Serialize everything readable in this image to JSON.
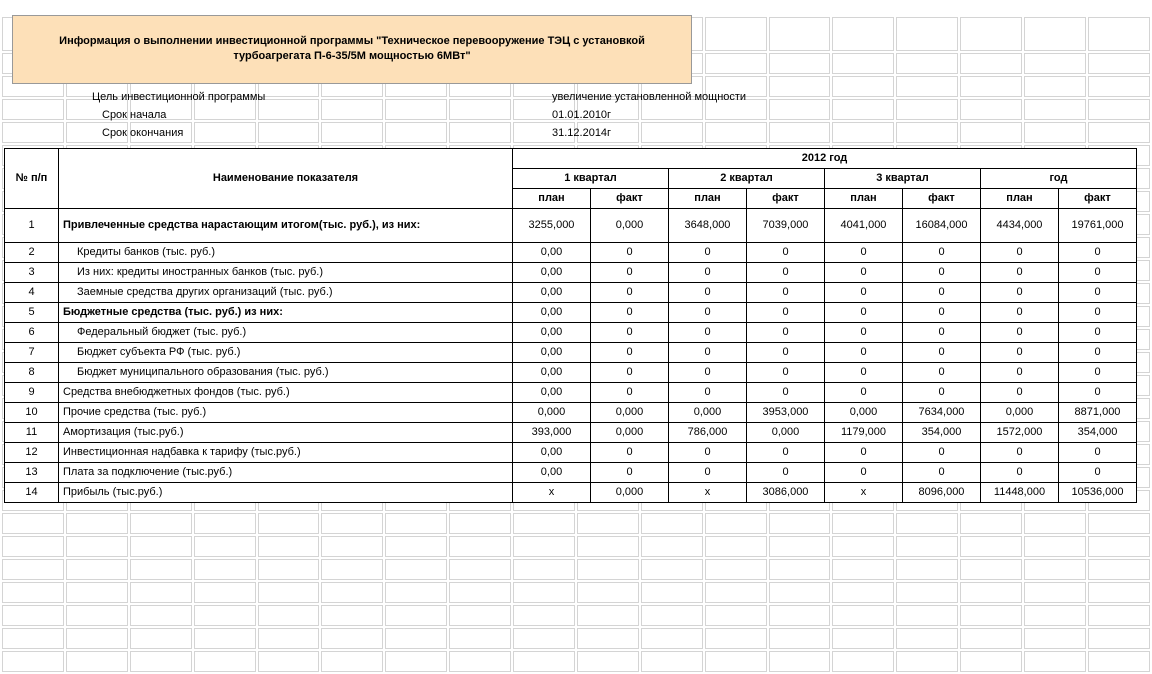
{
  "title": "Информация о выполнении инвестиционной программы  \"Техническое перевооружение ТЭЦ с установкой турбоагрегата П-6-35/5М мощностью 6МВт\"",
  "meta": {
    "goal_label": "Цель инвестиционной программы",
    "goal_value": "увеличение установленной мощности",
    "start_label": "Срок начала",
    "start_value": "01.01.2010г",
    "end_label": "Срок окончания",
    "end_value": "31.12.2014г"
  },
  "headers": {
    "num": "№ п/п",
    "name": "Наименование показателя",
    "year": "2012 год",
    "q1": "1 квартал",
    "q2": "2 квартал",
    "q3": "3 квартал",
    "year_col": "год",
    "plan": "план",
    "fact": "факт"
  },
  "rows": [
    {
      "num": "1",
      "name": "Привлеченные средства нарастающим итогом(тыс. руб.), из них:",
      "bold": true,
      "indent": 0,
      "q1p": "3255,000",
      "q1f": "0,000",
      "q2p": "3648,000",
      "q2f": "7039,000",
      "q3p": "4041,000",
      "q3f": "16084,000",
      "yp": "4434,000",
      "yf": "19761,000"
    },
    {
      "num": "2",
      "name": "Кредиты банков (тыс. руб.)",
      "bold": false,
      "indent": 1,
      "q1p": "0,00",
      "q1f": "0",
      "q2p": "0",
      "q2f": "0",
      "q3p": "0",
      "q3f": "0",
      "yp": "0",
      "yf": "0"
    },
    {
      "num": "3",
      "name": "Из них: кредиты иностранных банков (тыс. руб.)",
      "bold": false,
      "indent": 1,
      "q1p": "0,00",
      "q1f": "0",
      "q2p": "0",
      "q2f": "0",
      "q3p": "0",
      "q3f": "0",
      "yp": "0",
      "yf": "0"
    },
    {
      "num": "4",
      "name": "Заемные средства других организаций (тыс. руб.)",
      "bold": false,
      "indent": 1,
      "q1p": "0,00",
      "q1f": "0",
      "q2p": "0",
      "q2f": "0",
      "q3p": "0",
      "q3f": "0",
      "yp": "0",
      "yf": "0"
    },
    {
      "num": "5",
      "name": "Бюджетные средства (тыс. руб.) из них:",
      "bold": true,
      "indent": 0,
      "q1p": "0,00",
      "q1f": "0",
      "q2p": "0",
      "q2f": "0",
      "q3p": "0",
      "q3f": "0",
      "yp": "0",
      "yf": "0"
    },
    {
      "num": "6",
      "name": "Федеральный бюджет (тыс. руб.)",
      "bold": false,
      "indent": 1,
      "q1p": "0,00",
      "q1f": "0",
      "q2p": "0",
      "q2f": "0",
      "q3p": "0",
      "q3f": "0",
      "yp": "0",
      "yf": "0"
    },
    {
      "num": "7",
      "name": "Бюджет субъекта РФ (тыс. руб.)",
      "bold": false,
      "indent": 1,
      "q1p": "0,00",
      "q1f": "0",
      "q2p": "0",
      "q2f": "0",
      "q3p": "0",
      "q3f": "0",
      "yp": "0",
      "yf": "0"
    },
    {
      "num": "8",
      "name": "Бюджет муниципального образования (тыс. руб.)",
      "bold": false,
      "indent": 1,
      "q1p": "0,00",
      "q1f": "0",
      "q2p": "0",
      "q2f": "0",
      "q3p": "0",
      "q3f": "0",
      "yp": "0",
      "yf": "0"
    },
    {
      "num": "9",
      "name": "Средства внебюджетных фондов (тыс. руб.)",
      "bold": false,
      "indent": 0,
      "q1p": "0,00",
      "q1f": "0",
      "q2p": "0",
      "q2f": "0",
      "q3p": "0",
      "q3f": "0",
      "yp": "0",
      "yf": "0"
    },
    {
      "num": "10",
      "name": "Прочие средства (тыс. руб.)",
      "bold": false,
      "indent": 0,
      "q1p": "0,000",
      "q1f": "0,000",
      "q2p": "0,000",
      "q2f": "3953,000",
      "q3p": "0,000",
      "q3f": "7634,000",
      "yp": "0,000",
      "yf": "8871,000"
    },
    {
      "num": "11",
      "name": "Амортизация (тыс.руб.)",
      "bold": false,
      "indent": 0,
      "q1p": "393,000",
      "q1f": "0,000",
      "q2p": "786,000",
      "q2f": "0,000",
      "q3p": "1179,000",
      "q3f": "354,000",
      "yp": "1572,000",
      "yf": "354,000"
    },
    {
      "num": "12",
      "name": "Инвестиционная надбавка к тарифу (тыс.руб.)",
      "bold": false,
      "indent": 0,
      "q1p": "0,00",
      "q1f": "0",
      "q2p": "0",
      "q2f": "0",
      "q3p": "0",
      "q3f": "0",
      "yp": "0",
      "yf": "0"
    },
    {
      "num": "13",
      "name": "Плата за подключение (тыс.руб.)",
      "bold": false,
      "indent": 0,
      "q1p": "0,00",
      "q1f": "0",
      "q2p": "0",
      "q2f": "0",
      "q3p": "0",
      "q3f": "0",
      "yp": "0",
      "yf": "0"
    },
    {
      "num": "14",
      "name": "Прибыль (тыс.руб.)",
      "bold": false,
      "indent": 0,
      "q1p": "x",
      "q1f": "0,000",
      "q2p": "x",
      "q2f": "3086,000",
      "q3p": "x",
      "q3f": "8096,000",
      "yp": "11448,000",
      "yf": "10536,000"
    }
  ]
}
